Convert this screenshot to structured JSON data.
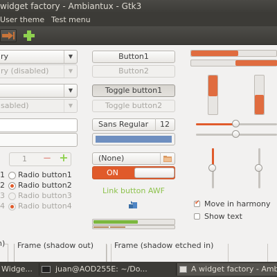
{
  "window": {
    "title": "widget factory - Ambiantux - Gtk3"
  },
  "menubar": {
    "items": [
      "User theme",
      "Test menu"
    ]
  },
  "combos": {
    "combo1": "ry",
    "combo2": "ry (disabled)",
    "combo3": "",
    "combo4": "sabled)"
  },
  "spin": {
    "value": "1",
    "minus": "−",
    "plus": "+"
  },
  "radios": [
    {
      "index": "1",
      "label": "Radio button1",
      "checked": false,
      "disabled": false
    },
    {
      "index": "2",
      "label": "Radio button2",
      "checked": true,
      "disabled": false
    },
    {
      "index": "3",
      "label": "Radio button3",
      "checked": false,
      "disabled": true
    },
    {
      "index": "4",
      "label": "Radio button4",
      "checked": true,
      "disabled": true
    }
  ],
  "buttons": {
    "button1": "Button1",
    "button2": "Button2",
    "toggle1": "Toggle button1",
    "toggle2": "Toggle button2"
  },
  "font_button": {
    "name": "Sans Regular",
    "size": "12"
  },
  "file_chooser": {
    "value": "(None)"
  },
  "switch": {
    "label": "ON",
    "state": true
  },
  "link_button": {
    "label": "Link button AWF"
  },
  "levels": {
    "progress1": 0.55,
    "progress2": 0.35,
    "level_bar": 0.6
  },
  "checks": {
    "move_in_harmony": {
      "label": "Move in harmony",
      "checked": true
    },
    "show_text": {
      "label": "Show text",
      "checked": false
    }
  },
  "frames": {
    "frame0": "n)",
    "frame1": "Frame (shadow out)",
    "frame2": "Frame (shadow etched in)"
  },
  "taskbar": {
    "items": [
      "Widge...",
      "juan@AOD255E: ~/Do...",
      "A widget factory - Amb..."
    ]
  },
  "colors": {
    "accent": "#e05a2a",
    "link": "#8dc24c",
    "titlebar": "#3c3b37",
    "color_button": "#6f8fc0"
  }
}
